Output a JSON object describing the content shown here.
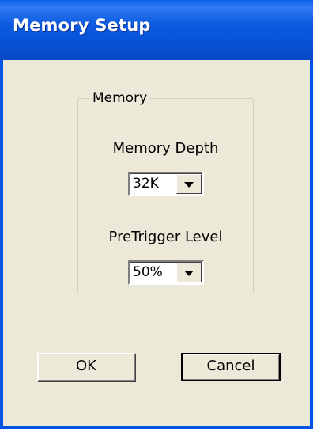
{
  "window": {
    "title": "Memory Setup"
  },
  "group": {
    "legend": "Memory",
    "memory_depth": {
      "label": "Memory Depth",
      "value": "32K"
    },
    "pretrigger_level": {
      "label": "PreTrigger Level",
      "value": "50%"
    }
  },
  "buttons": {
    "ok_label": "OK",
    "cancel_label": "Cancel"
  }
}
